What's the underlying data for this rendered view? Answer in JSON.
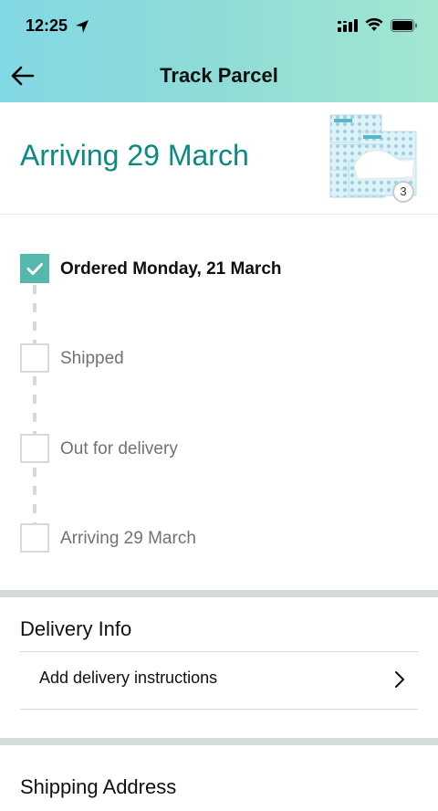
{
  "status_bar": {
    "time": "12:25"
  },
  "header": {
    "title": "Track Parcel"
  },
  "arrival": {
    "title": "Arriving 29 March",
    "quantity": "3"
  },
  "timeline": {
    "steps": [
      {
        "label": "Ordered Monday, 21 March",
        "completed": true
      },
      {
        "label": "Shipped",
        "completed": false
      },
      {
        "label": "Out for delivery",
        "completed": false
      },
      {
        "label": "Arriving 29 March",
        "completed": false
      }
    ]
  },
  "delivery_info": {
    "title": "Delivery Info",
    "add_instructions_label": "Add delivery instructions"
  },
  "shipping_address": {
    "title": "Shipping Address"
  },
  "colors": {
    "accent": "#0b8a83",
    "check": "#54b8ae",
    "header_start": "#82d8e4",
    "header_end": "#a3e6d2"
  }
}
